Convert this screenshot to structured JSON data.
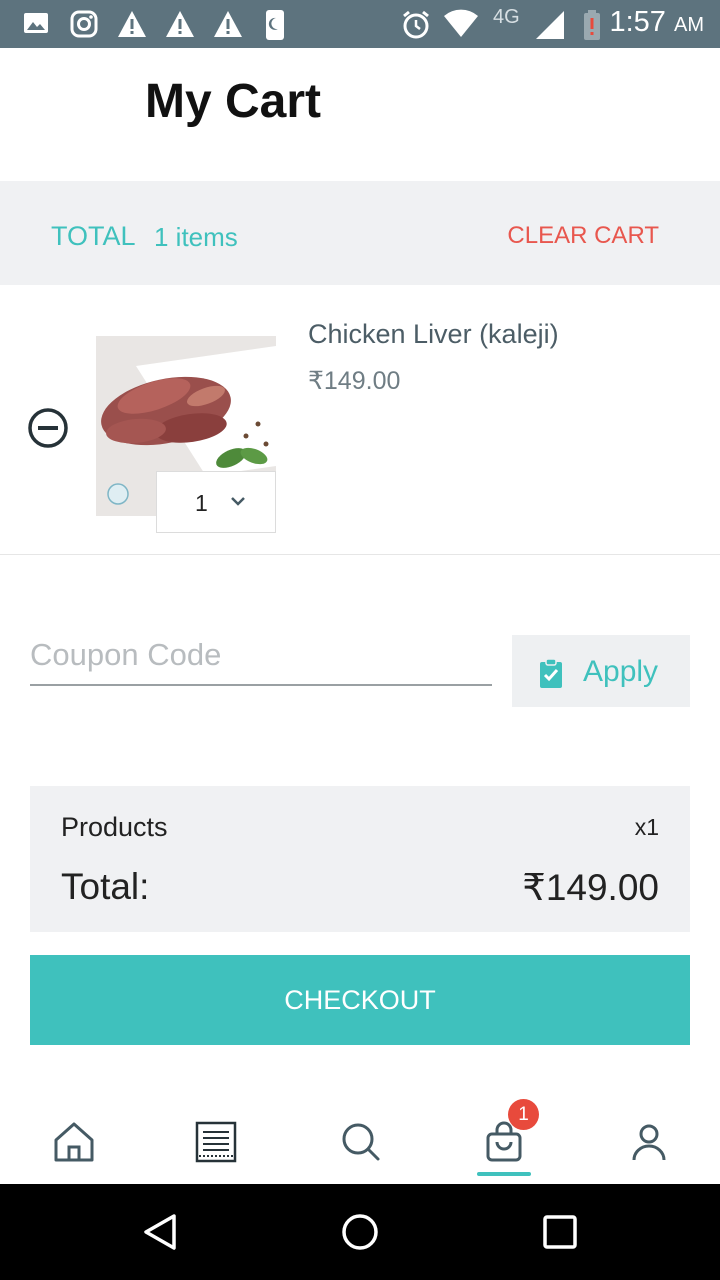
{
  "status_bar": {
    "time": "1:57",
    "ampm": "AM",
    "network": "4G",
    "icons": [
      "image-icon",
      "instagram-icon",
      "warning-icon",
      "warning-icon",
      "warning-icon",
      "phone-icon",
      "alarm-icon",
      "wifi-icon",
      "signal-icon",
      "battery-low-icon"
    ]
  },
  "header": {
    "title": "My Cart"
  },
  "summary": {
    "total_label": "TOTAL",
    "items_count": "1 items",
    "clear_cart_label": "CLEAR CART"
  },
  "cart": {
    "items": [
      {
        "name": "Chicken Liver (kaleji)",
        "price": "₹149.00",
        "quantity": "1"
      }
    ]
  },
  "coupon": {
    "placeholder": "Coupon Code",
    "value": "",
    "apply_label": "Apply"
  },
  "totals": {
    "products_label": "Products",
    "products_qty": "x1",
    "total_label": "Total:",
    "total_amount": "₹149.00"
  },
  "checkout": {
    "label": "CHECKOUT"
  },
  "bottom_nav": {
    "items": [
      "home-icon",
      "catalog-icon",
      "search-icon",
      "cart-icon",
      "profile-icon"
    ],
    "cart_badge": "1",
    "active": "cart"
  },
  "colors": {
    "accent": "#3fc1bd",
    "danger": "#e8574e",
    "badge": "#e84a3c",
    "status_bar": "#5d737e"
  }
}
